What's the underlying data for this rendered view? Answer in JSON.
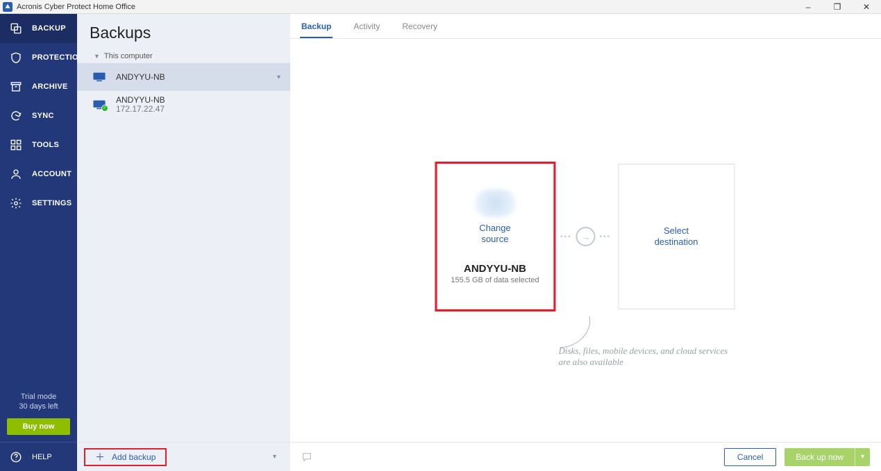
{
  "window": {
    "title": "Acronis Cyber Protect Home Office"
  },
  "sidebar": {
    "items": [
      {
        "label": "BACKUP"
      },
      {
        "label": "PROTECTION"
      },
      {
        "label": "ARCHIVE"
      },
      {
        "label": "SYNC"
      },
      {
        "label": "TOOLS"
      },
      {
        "label": "ACCOUNT"
      },
      {
        "label": "SETTINGS"
      }
    ],
    "trial_line1": "Trial mode",
    "trial_line2": "30 days left",
    "buy": "Buy now",
    "help": "HELP"
  },
  "list": {
    "title": "Backups",
    "group": "This computer",
    "items": [
      {
        "name": "ANDYYU-NB"
      },
      {
        "name": "ANDYYU-NB",
        "ip": "172.17.22.47"
      }
    ],
    "add": "Add backup"
  },
  "tabs": [
    {
      "label": "Backup"
    },
    {
      "label": "Activity"
    },
    {
      "label": "Recovery"
    }
  ],
  "source": {
    "change": "Change\nsource",
    "change_l1": "Change",
    "change_l2": "source",
    "name": "ANDYYU-NB",
    "detail": "155.5 GB of data selected"
  },
  "destination": {
    "select_l1": "Select",
    "select_l2": "destination"
  },
  "hint": "Disks, files, mobile devices, and cloud services are also available",
  "buttons": {
    "cancel": "Cancel",
    "backup_now": "Back up now"
  }
}
